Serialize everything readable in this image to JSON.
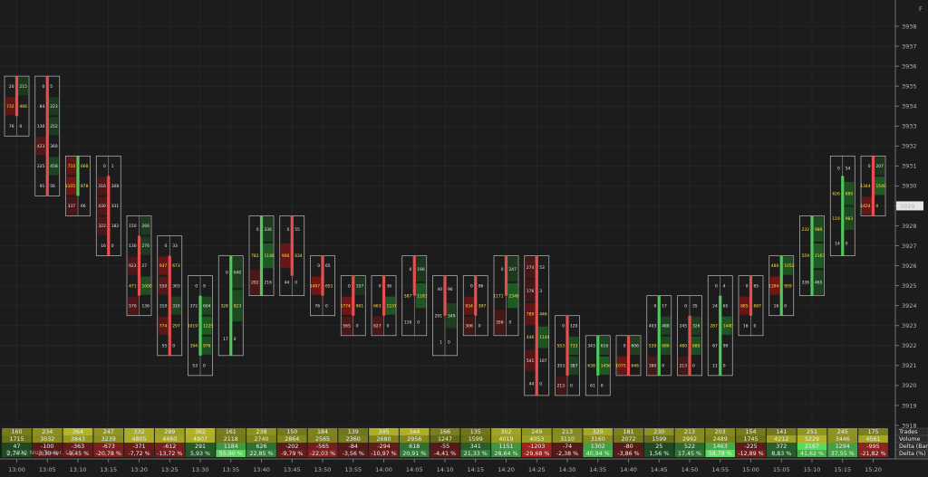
{
  "price_axis": {
    "ticks": [
      "3938",
      "3937",
      "3936",
      "3935",
      "3934",
      "3933",
      "3932",
      "3931",
      "3930",
      "3929",
      "3928",
      "3927",
      "3926",
      "3925",
      "3924",
      "3923",
      "3922",
      "3921",
      "3920",
      "3919",
      "3918"
    ],
    "current_price": "3929",
    "corner_label": "F"
  },
  "time_axis": {
    "ticks": [
      "13:00",
      "13:05",
      "13:10",
      "13:15",
      "13:20",
      "13:25",
      "13:30",
      "13:35",
      "13:40",
      "13:45",
      "13:50",
      "13:55",
      "14:00",
      "14:05",
      "14:10",
      "14:15",
      "14:20",
      "14:25",
      "14:30",
      "14:35",
      "14:40",
      "14:45",
      "14:50",
      "14:55",
      "15:00",
      "15:05",
      "15:10",
      "15:15",
      "15:20"
    ]
  },
  "colors": {
    "background": "#1c1c1c",
    "grid": "#2a2a2a",
    "up_bar": "#52c75e",
    "down_bar": "#e45050",
    "bid_cell": "#7a1414",
    "ask_cell": "#1f5f24",
    "current_price_tag": "#e6e6e6"
  },
  "chart_data": {
    "type": "footprint",
    "price_range": [
      3918,
      3938
    ],
    "candles": [
      {
        "time": "13:00",
        "open": 3935,
        "high": 3935,
        "low": 3933,
        "close": 3934,
        "rows": [
          [
            "20",
            "215"
          ],
          [
            "732",
            "466"
          ],
          [
            "76",
            "0"
          ]
        ]
      },
      {
        "time": "13:05",
        "open": 3935,
        "high": 3935,
        "low": 3930,
        "close": 3930,
        "rows": [
          [
            "0",
            "5"
          ],
          [
            "84",
            "223"
          ],
          [
            "130",
            "252"
          ],
          [
            "423",
            "360"
          ],
          [
            "335",
            "458"
          ],
          [
            "91",
            "56"
          ]
        ]
      },
      {
        "time": "13:10",
        "open": 3930,
        "high": 3931,
        "low": 3929,
        "close": 3931,
        "rows": [
          [
            "710",
            "668"
          ],
          [
            "1105",
            "878"
          ],
          [
            "337",
            "66"
          ]
        ]
      },
      {
        "time": "13:15",
        "open": 3930,
        "high": 3931,
        "low": 3927,
        "close": 3927,
        "rows": [
          [
            "0",
            "1"
          ],
          [
            "316",
            "308"
          ],
          [
            "430",
            "331"
          ],
          [
            "322",
            "182"
          ],
          [
            "16",
            "0"
          ]
        ]
      },
      {
        "time": "13:20",
        "open": 3927,
        "high": 3928,
        "low": 3924,
        "close": 3925,
        "rows": [
          [
            "150",
            "266"
          ],
          [
            "130",
            "276"
          ],
          [
            "623",
            "27"
          ],
          [
            "471",
            "1000"
          ],
          [
            "570",
            "136"
          ]
        ]
      },
      {
        "time": "13:25",
        "open": 3926,
        "high": 3927,
        "low": 3922,
        "close": 3922,
        "rows": [
          [
            "0",
            "33"
          ],
          [
            "937",
            "673"
          ],
          [
            "550",
            "303"
          ],
          [
            "310",
            "310"
          ],
          [
            "774",
            "297"
          ],
          [
            "55",
            "0"
          ]
        ]
      },
      {
        "time": "13:30",
        "open": 3922,
        "high": 3925,
        "low": 3921,
        "close": 3924,
        "rows": [
          [
            "0",
            "9"
          ],
          [
            "372",
            "604"
          ],
          [
            "1019",
            "1225"
          ],
          [
            "394",
            "976"
          ],
          [
            "53",
            "0"
          ]
        ]
      },
      {
        "time": "13:35",
        "open": 3922,
        "high": 3926,
        "low": 3922,
        "close": 3926,
        "rows": [
          [
            "0",
            "640"
          ],
          [
            "328",
            "823"
          ],
          [
            "17",
            "0"
          ]
        ]
      },
      {
        "time": "13:40",
        "open": 3925,
        "high": 3928,
        "low": 3925,
        "close": 3928,
        "rows": [
          [
            "0",
            "336"
          ],
          [
            "782",
            "1148"
          ],
          [
            "292",
            "216"
          ]
        ]
      },
      {
        "time": "13:45",
        "open": 3928,
        "high": 3928,
        "low": 3925,
        "close": 3926,
        "rows": [
          [
            "0",
            "55"
          ],
          [
            "906",
            "634"
          ],
          [
            "44",
            "0"
          ]
        ]
      },
      {
        "time": "13:50",
        "open": 3926,
        "high": 3926,
        "low": 3924,
        "close": 3925,
        "rows": [
          [
            "0",
            "65"
          ],
          [
            "1497",
            "651"
          ],
          [
            "76",
            "0"
          ]
        ]
      },
      {
        "time": "13:55",
        "open": 3925,
        "high": 3925,
        "low": 3923,
        "close": 3924,
        "rows": [
          [
            "0",
            "157"
          ],
          [
            "1774",
            "901"
          ],
          [
            "565",
            "0"
          ]
        ]
      },
      {
        "time": "14:00",
        "open": 3925,
        "high": 3925,
        "low": 3923,
        "close": 3924,
        "rows": [
          [
            "0",
            "36"
          ],
          [
            "663",
            "1107"
          ],
          [
            "627",
            "0"
          ]
        ]
      },
      {
        "time": "14:05",
        "open": 3926,
        "high": 3926,
        "low": 3923,
        "close": 3925,
        "rows": [
          [
            "0",
            "190"
          ],
          [
            "587",
            "1183"
          ],
          [
            "116",
            "0"
          ]
        ]
      },
      {
        "time": "14:10",
        "open": 3925,
        "high": 3925,
        "low": 3922,
        "close": 3924,
        "rows": [
          [
            "40",
            "96"
          ],
          [
            "291",
            "349"
          ],
          [
            "1",
            "0"
          ]
        ]
      },
      {
        "time": "14:15",
        "open": 3925,
        "high": 3925,
        "low": 3923,
        "close": 3924,
        "rows": [
          [
            "0",
            "96"
          ],
          [
            "934",
            "397"
          ],
          [
            "306",
            "0"
          ]
        ]
      },
      {
        "time": "14:20",
        "open": 3926,
        "high": 3926,
        "low": 3923,
        "close": 3925,
        "rows": [
          [
            "0",
            "247"
          ],
          [
            "1171",
            "2348"
          ],
          [
            "356",
            "0"
          ]
        ]
      },
      {
        "time": "14:25",
        "open": 3926,
        "high": 3926,
        "low": 3920,
        "close": 3920,
        "rows": [
          [
            "274",
            "53"
          ],
          [
            "176",
            "3"
          ],
          [
            "789",
            "446"
          ],
          [
            "446",
            "1144"
          ],
          [
            "541",
            "187"
          ],
          [
            "44",
            "0"
          ]
        ]
      },
      {
        "time": "14:30",
        "open": 3923,
        "high": 3923,
        "low": 3920,
        "close": 3921,
        "rows": [
          [
            "0",
            "120"
          ],
          [
            "553",
            "733"
          ],
          [
            "353",
            "387"
          ],
          [
            "213",
            "0"
          ]
        ]
      },
      {
        "time": "14:35",
        "open": 3921,
        "high": 3922,
        "low": 3920,
        "close": 3922,
        "rows": [
          [
            "343",
            "616"
          ],
          [
            "638",
            "1456"
          ],
          [
            "61",
            "0"
          ]
        ]
      },
      {
        "time": "14:40",
        "open": 3922,
        "high": 3922,
        "low": 3921,
        "close": 3921,
        "rows": [
          [
            "0",
            "606"
          ],
          [
            "1075",
            "646"
          ]
        ]
      },
      {
        "time": "14:45",
        "open": 3921,
        "high": 3924,
        "low": 3921,
        "close": 3924,
        "rows": [
          [
            "0",
            "17"
          ],
          [
            "403",
            "488"
          ],
          [
            "539",
            "686"
          ],
          [
            "380",
            "0"
          ]
        ]
      },
      {
        "time": "14:50",
        "open": 3923,
        "high": 3924,
        "low": 3921,
        "close": 3921,
        "rows": [
          [
            "0",
            "35"
          ],
          [
            "245",
            "326"
          ],
          [
            "480",
            "880"
          ],
          [
            "213",
            "0"
          ]
        ]
      },
      {
        "time": "14:55",
        "open": 3921,
        "high": 3925,
        "low": 3921,
        "close": 3924,
        "rows": [
          [
            "0",
            "4"
          ],
          [
            "24",
            "65"
          ],
          [
            "287",
            "1440"
          ],
          [
            "67",
            "99"
          ],
          [
            "11",
            "0"
          ]
        ]
      },
      {
        "time": "15:00",
        "open": 3925,
        "high": 3925,
        "low": 3923,
        "close": 3924,
        "rows": [
          [
            "0",
            "65"
          ],
          [
            "885",
            "687"
          ],
          [
            "16",
            "0"
          ]
        ]
      },
      {
        "time": "15:05",
        "open": 3924,
        "high": 3926,
        "low": 3924,
        "close": 3926,
        "rows": [
          [
            "480",
            "1052"
          ],
          [
            "1394",
            "959"
          ],
          [
            "16",
            "0"
          ]
        ]
      },
      {
        "time": "15:10",
        "open": 3925,
        "high": 3928,
        "low": 3925,
        "close": 3928,
        "rows": [
          [
            "232",
            "986"
          ],
          [
            "559",
            "2167"
          ],
          [
            "336",
            "465"
          ]
        ]
      },
      {
        "time": "15:15",
        "open": 3927,
        "high": 3931,
        "low": 3927,
        "close": 3930,
        "rows": [
          [
            "0",
            "54"
          ],
          [
            "626",
            "880"
          ],
          [
            "119",
            "983"
          ],
          [
            "14",
            "0"
          ]
        ]
      },
      {
        "time": "15:20",
        "open": 3931,
        "high": 3931,
        "low": 3929,
        "close": 3929,
        "rows": [
          [
            "0",
            "207"
          ],
          [
            "1344",
            "1540"
          ],
          [
            "1424",
            "0"
          ]
        ]
      }
    ],
    "statistics": {
      "labels": [
        "Trades",
        "Volume",
        "Delta (Bar)",
        "Delta (%)"
      ],
      "trades": [
        "160",
        "234",
        "364",
        "247",
        "332",
        "289",
        "362",
        "161",
        "238",
        "150",
        "184",
        "139",
        "345",
        "344",
        "166",
        "135",
        "302",
        "249",
        "213",
        "320",
        "181",
        "230",
        "213",
        "203",
        "154",
        "141",
        "251",
        "245",
        "175"
      ],
      "volume": [
        "1715",
        "3032",
        "3843",
        "3239",
        "4805",
        "4460",
        "4907",
        "2118",
        "2740",
        "2864",
        "2565",
        "2360",
        "2680",
        "2956",
        "1247",
        "1599",
        "4019",
        "4053",
        "3110",
        "3160",
        "2072",
        "1599",
        "2992",
        "2489",
        "1745",
        "4212",
        "5229",
        "3446",
        "4561"
      ],
      "delta_bar": [
        "47",
        "-100",
        "-363",
        "-673",
        "-371",
        "-612",
        "291",
        "1184",
        "626",
        "-202",
        "-565",
        "-84",
        "-294",
        "618",
        "-55",
        "341",
        "1151",
        "-1203",
        "-74",
        "1302",
        "-80",
        "25",
        "522",
        "1463",
        "-225",
        "372",
        "2167",
        "1294",
        "-995"
      ],
      "delta_pct": [
        "2,74 %",
        "-3,30 %",
        "-9,45 %",
        "-20,78 %",
        "-7,72 %",
        "-13,72 %",
        "5,93 %",
        "55,90 %",
        "22,85 %",
        "-9,79 %",
        "-22,03 %",
        "-3,56 %",
        "-10,97 %",
        "20,91 %",
        "-4,41 %",
        "21,33 %",
        "28,64 %",
        "-29,68 %",
        "-2,38 %",
        "40,94 %",
        "-3,86 %",
        "1,56 %",
        "17,45 %",
        "58,78 %",
        "-12,89 %",
        "8,83 %",
        "41,62 %",
        "37,55 %",
        "-21,82 %"
      ]
    }
  },
  "copyright": "© 2020 NinjaTrader, LLC"
}
